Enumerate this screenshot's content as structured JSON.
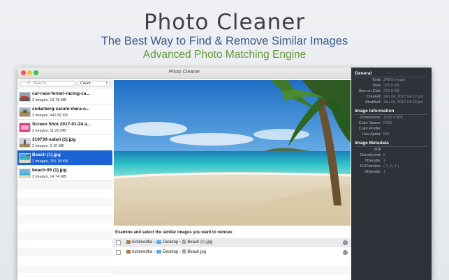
{
  "hero": {
    "title": "Photo Cleaner",
    "subtitle": "The Best Way to Find & Remove Similar Images",
    "tagline": "Advanced Photo Matching Engine"
  },
  "window": {
    "title": "Photo Cleaner"
  },
  "sidebar": {
    "search_placeholder": "Search",
    "sort_value": "Count",
    "items": [
      {
        "name": "car-race-ferrari-racing-ca...",
        "meta": "3 images, 13.78 MB",
        "selected": false
      },
      {
        "name": "cedarberg-saruni-mara-o...",
        "meta": "3 images, 442.56 KB",
        "selected": false
      },
      {
        "name": "Screen Shot 2017-01-24 a...",
        "meta": "3 images, 11.20 MB",
        "selected": false
      },
      {
        "name": "319730-safari (1).jpg",
        "meta": "2 images, 2.10 MB",
        "selected": false
      },
      {
        "name": "Beach (1).jpg",
        "meta": "2 images, 751.78 KB",
        "selected": true
      },
      {
        "name": "beach-05 (1).jpg",
        "meta": "2 images, 14.74 MB",
        "selected": false
      }
    ]
  },
  "main": {
    "caption": "Examine and select the similar images you want to remove",
    "rows": [
      {
        "user": "rishimodha",
        "folder": "Desktop",
        "file": "Beach (1).jpg"
      },
      {
        "user": "rishimodha",
        "folder": "Desktop",
        "file": "Beach.jpg"
      }
    ]
  },
  "inspector": {
    "general": {
      "heading": "General",
      "fields": [
        {
          "key": "Kind:",
          "value": "JPEG image"
        },
        {
          "key": "Size:",
          "value": "375.9 KB"
        },
        {
          "key": "Size on Disk:",
          "value": "376.8 KB"
        },
        {
          "key": "Created:",
          "value": "Jan 24, 2017 04:12 pm"
        },
        {
          "key": "Modified:",
          "value": "Jan 24, 2017 04:12 pm"
        }
      ]
    },
    "info": {
      "heading": "Image Information",
      "fields": [
        {
          "key": "Dimensions:",
          "value": "1600 x 900"
        },
        {
          "key": "Color Space:",
          "value": "RGB"
        },
        {
          "key": "Color Profile:",
          "value": ""
        },
        {
          "key": "Has Alpha:",
          "value": "NO"
        }
      ]
    },
    "metadata": {
      "heading": "Image Metadata",
      "fields": [
        {
          "key": "JFIF",
          "value": ""
        },
        {
          "key": "DensityUnit:",
          "value": "0"
        },
        {
          "key": "YDensity:",
          "value": "1"
        },
        {
          "key": "JFIFVersion:",
          "value": "( 1, 0, 1 )"
        },
        {
          "key": "XDensity:",
          "value": "1"
        }
      ]
    }
  },
  "colors": {
    "selection": "#1b63d4",
    "inspector_bg": "#2e3339",
    "subtitle_blue": "#3c5a8c",
    "tagline_green": "#5f9b3b"
  }
}
